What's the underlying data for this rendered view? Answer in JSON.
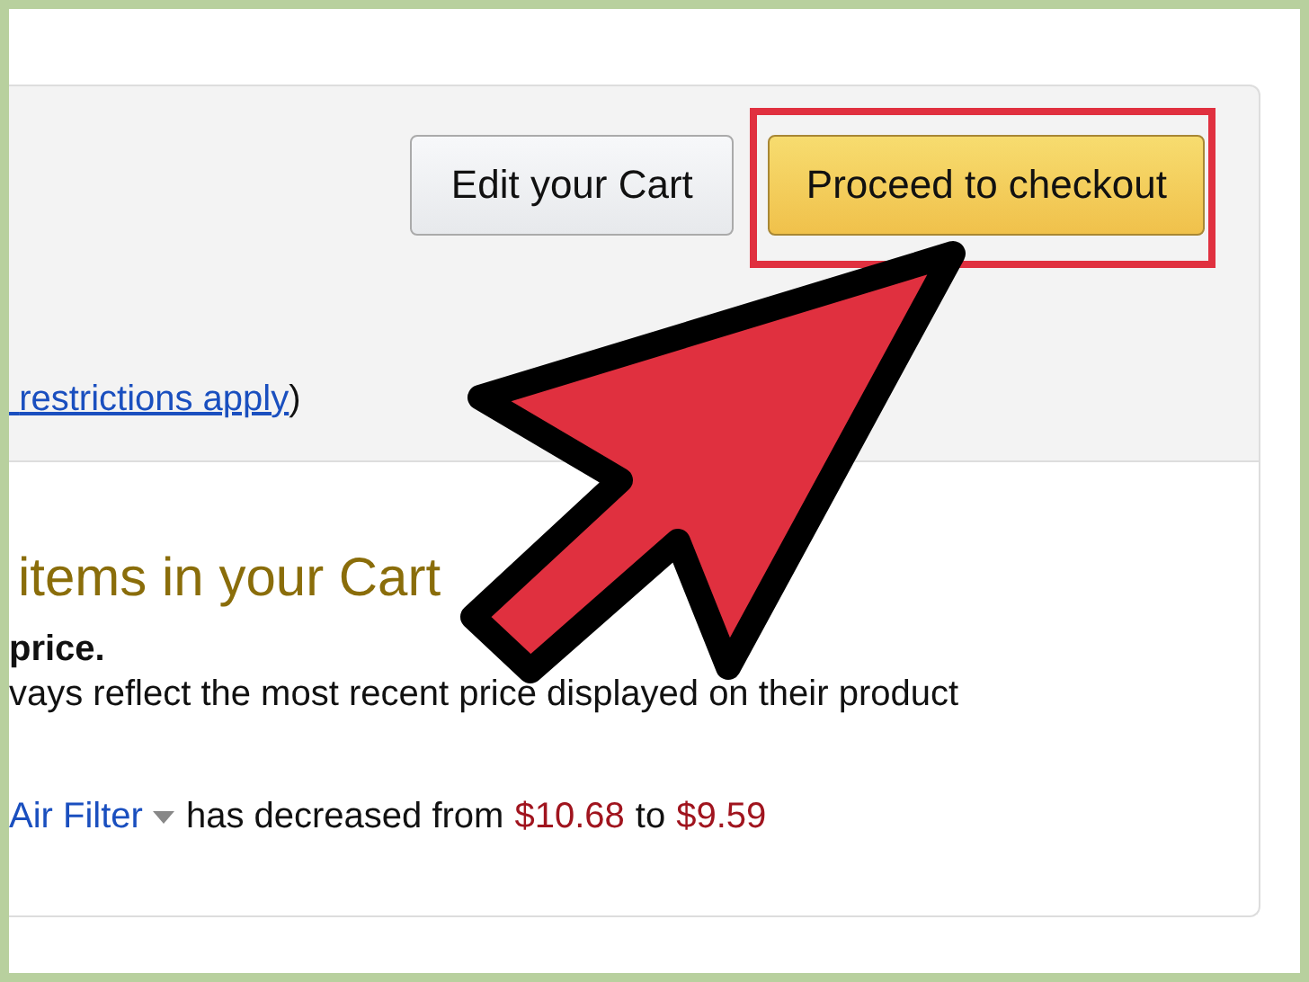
{
  "buttons": [
    {
      "label": "Edit your Cart",
      "kind": "secondary",
      "highlighted": false
    },
    {
      "label": "Proceed to checkout",
      "kind": "primary",
      "highlighted": true
    }
  ],
  "restrictions": {
    "link": "restrictions apply",
    "suffix": ")"
  },
  "cart": {
    "heading": "items in your Cart",
    "notice_title": "price.",
    "notice_text": "vays reflect the most recent price displayed on their product",
    "price_change": {
      "item": "Air Filter",
      "text_1": "has decreased from",
      "old_price": "$10.68",
      "text_2": "to",
      "new_price": "$9.59"
    }
  }
}
